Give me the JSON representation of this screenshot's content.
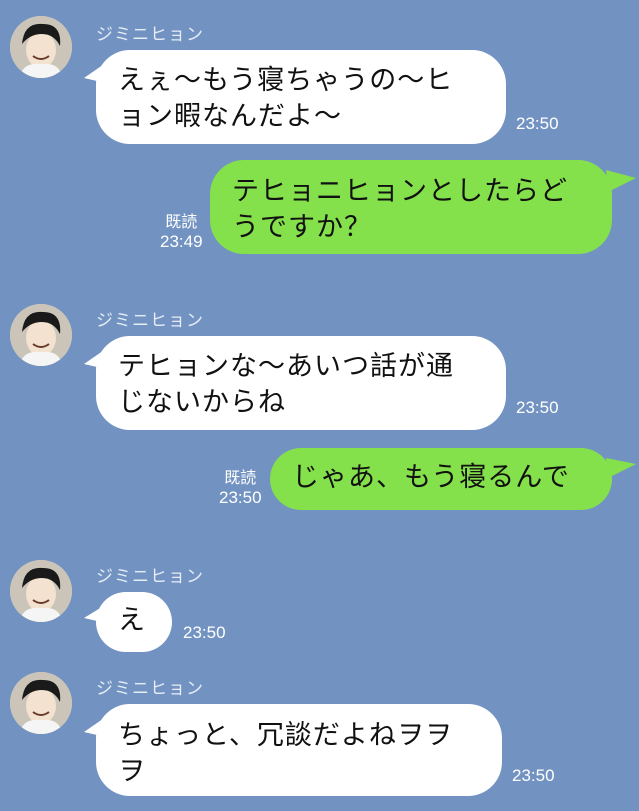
{
  "chat": {
    "background_color": "#7293c2",
    "incoming_bubble_color": "#ffffff",
    "outgoing_bubble_color": "#84e04b",
    "messages": [
      {
        "sender": "ジミニヒョン",
        "text_line1": "えぇ〜もう寝ちゃうの〜ヒ",
        "text_line2": "ョン暇なんだよ〜",
        "time": "23:50"
      },
      {
        "sender": "me",
        "text_line1": "テヒョニヒョンとしたらど",
        "text_line2": "うですか？",
        "read": "既読",
        "time": "23:49"
      },
      {
        "sender": "ジミニヒョン",
        "text_line1": "テヒョンな〜あいつ話が通",
        "text_line2": "じないからね",
        "time": "23:50"
      },
      {
        "sender": "me",
        "text": "じゃあ、もう寝るんで",
        "read": "既読",
        "time": "23:50"
      },
      {
        "sender": "ジミニヒョン",
        "text": "え",
        "time": "23:50"
      },
      {
        "sender": "ジミニヒョン",
        "text_line1": "ちょっと、冗談だよねヲヲ",
        "text_line2": "ヲ",
        "time": "23:50"
      }
    ]
  }
}
